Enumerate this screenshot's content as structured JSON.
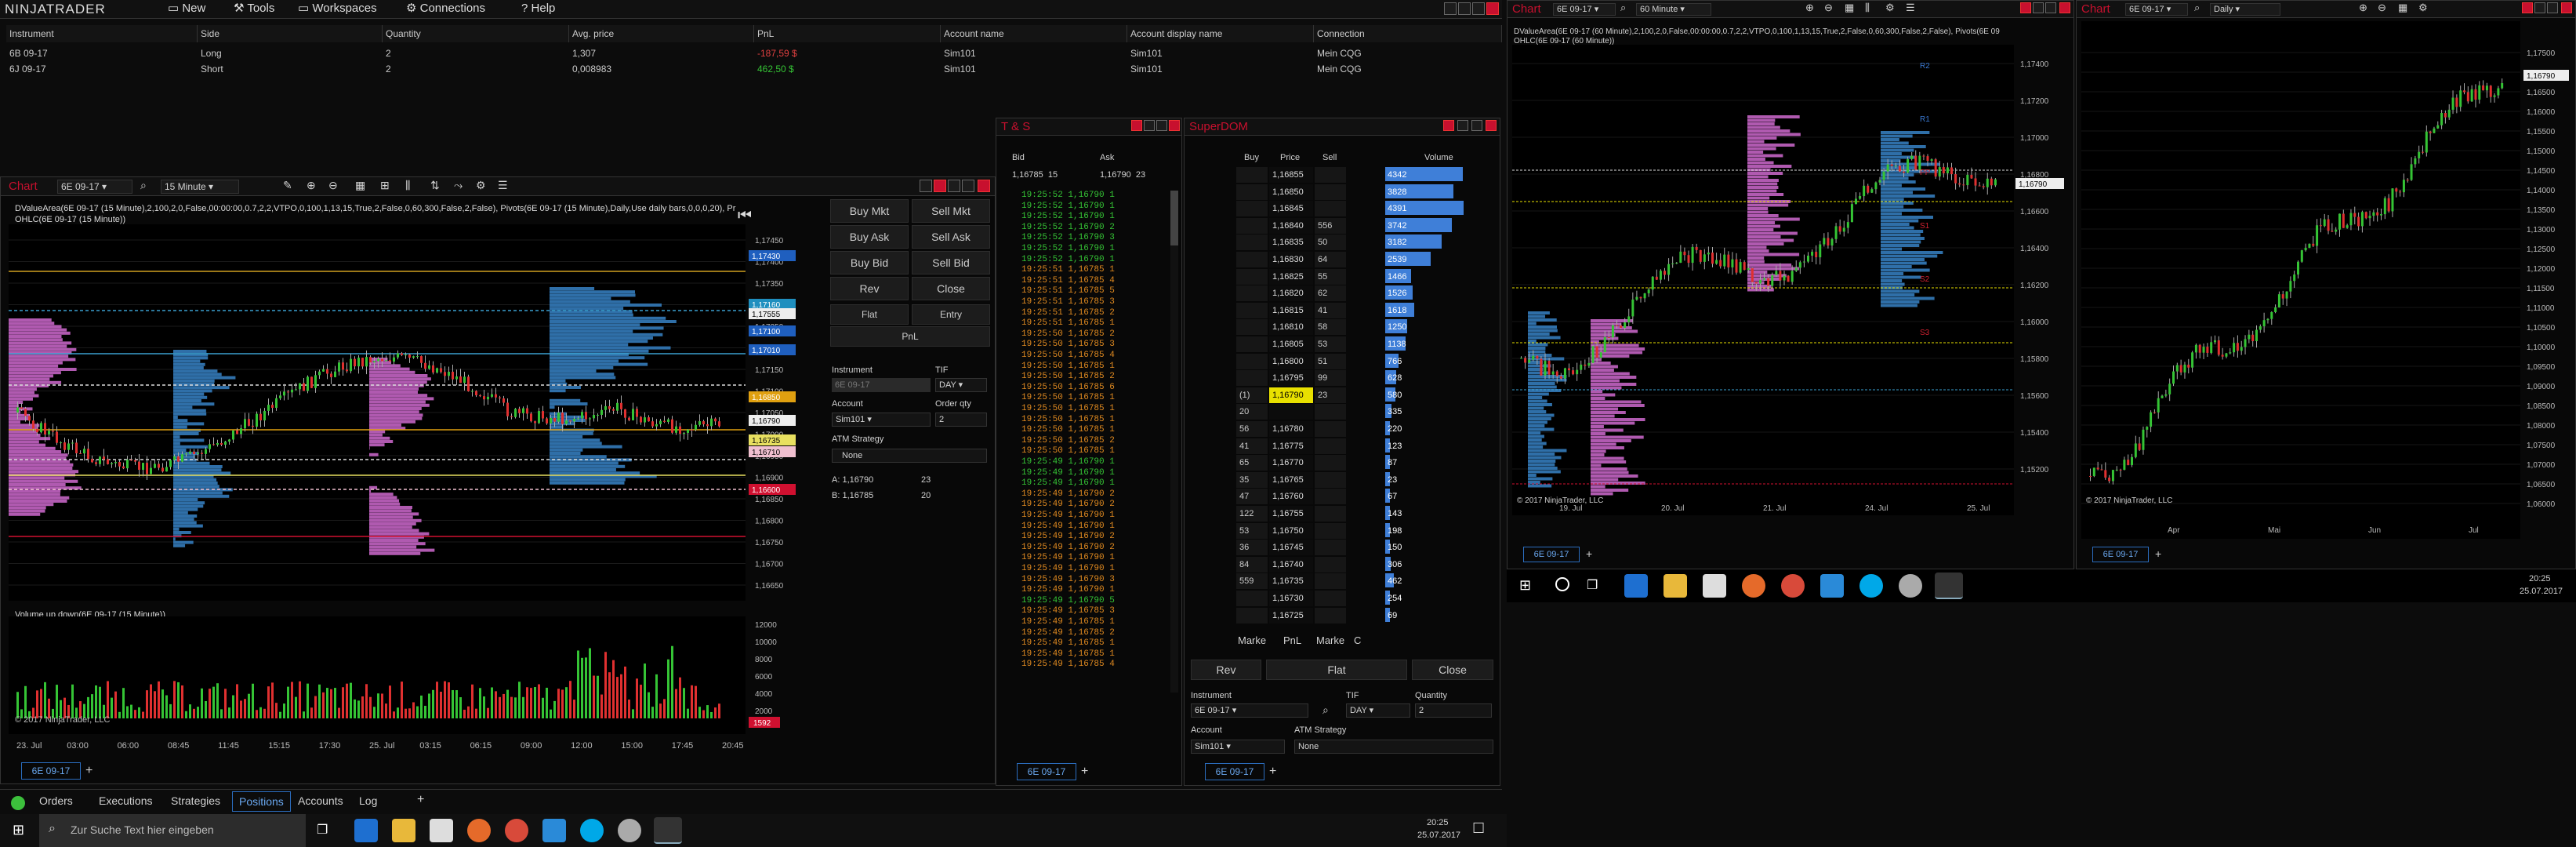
{
  "app": {
    "logo": "NINJATRADER",
    "menu": [
      "New",
      "Tools",
      "Workspaces",
      "Connections",
      "Help"
    ]
  },
  "positions": {
    "headers": [
      "Instrument",
      "Side",
      "Quantity",
      "Avg. price",
      "PnL",
      "Account name",
      "Account display name",
      "Connection"
    ],
    "rows": [
      [
        "6B 09-17",
        "Long",
        "2",
        "1,307",
        "-187,59 $",
        "Sim101",
        "Sim101",
        "Mein CQG"
      ],
      [
        "6J 09-17",
        "Short",
        "2",
        "0,008983",
        "462,50 $",
        "Sim101",
        "Sim101",
        "Mein CQG"
      ]
    ],
    "pnl_colors": [
      "#e04040",
      "#35c435"
    ]
  },
  "chart1": {
    "title": "Chart",
    "instrument": "6E 09-17",
    "interval": "15 Minute",
    "indicator_line1": "DValueArea(6E 09-17 (15 Minute),2,100,2,0,False,00:00:00,0.7,2,2,VTPO,0,100,1,13,15,True,2,False,0,60,300,False,2,False), Pivots(6E 09-17 (15 Minute),Daily,Use daily bars,0,0,0,20), Prior day",
    "indicator_line2": "OHLC(6E 09-17 (15 Minute))",
    "copyright": "© 2017 NinjaTrader, LLC",
    "volume_label": "Volume up down(6E 09-17 (15 Minute))",
    "price_labels": [
      "1,17450",
      "1,17400",
      "1,17350",
      "1,17300",
      "1,17250",
      "1,17200",
      "1,17150",
      "1,17100",
      "1,17050",
      "1,17000",
      "1,16950",
      "1,16900",
      "1,16850",
      "1,16800",
      "1,16750",
      "1,16700",
      "1,16650"
    ],
    "price_tags": [
      {
        "t": "1,17430",
        "c": "#1f5fbf"
      },
      {
        "t": "1,17160",
        "c": "#1f8fbf"
      },
      {
        "t": "1,17555",
        "c": "#eeeeee"
      },
      {
        "t": "1,17100",
        "c": "#1f5fbf"
      },
      {
        "t": "1,17010",
        "c": "#1f5fbf"
      },
      {
        "t": "1,16850",
        "c": "#e0a010"
      },
      {
        "t": "1,16790",
        "c": "#eeeeee"
      },
      {
        "t": "1,16735",
        "c": "#e8e060"
      },
      {
        "t": "1,16710",
        "c": "#f0c0d0"
      },
      {
        "t": "1,16600",
        "c": "#d01030"
      }
    ],
    "volume_labels": [
      "12000",
      "10000",
      "8000",
      "6000",
      "4000",
      "2000"
    ],
    "volume_tag": "1592",
    "time_labels": [
      "23. Jul",
      "03:00",
      "06:00",
      "08:45",
      "11:45",
      "15:15",
      "17:30",
      "25. Jul",
      "03:15",
      "06:15",
      "09:00",
      "12:00",
      "15:00",
      "17:45",
      "20:45"
    ],
    "tab": "6E 09-17"
  },
  "chart_trader": {
    "buttons": [
      "Buy Mkt",
      "Sell Mkt",
      "Buy Ask",
      "Sell Ask",
      "Buy Bid",
      "Sell Bid",
      "Rev",
      "Close",
      "Flat",
      "Entry",
      "PnL"
    ],
    "instrument_label": "Instrument",
    "instrument": "6E 09-17",
    "tif_label": "TIF",
    "tif": "DAY",
    "account_label": "Account",
    "account": "Sim101",
    "qty_label": "Order qty",
    "qty": "2",
    "atm_label": "ATM Strategy",
    "atm": "None",
    "ask_prefix": "A:",
    "ask": "1,16790",
    "ask_size": "23",
    "bid_prefix": "B:",
    "bid": "1,16785",
    "bid_size": "20"
  },
  "ts": {
    "title": "T & S",
    "headers": [
      "Bid",
      "Ask"
    ],
    "bid": "1,16785",
    "bid_size": "15",
    "ask": "1,16790",
    "ask_size": "23",
    "rows": [
      [
        "19:25:52",
        "1,16790",
        "1",
        "g"
      ],
      [
        "19:25:52",
        "1,16790",
        "1",
        "g"
      ],
      [
        "19:25:52",
        "1,16790",
        "1",
        "g"
      ],
      [
        "19:25:52",
        "1,16790",
        "2",
        "g"
      ],
      [
        "19:25:52",
        "1,16790",
        "3",
        "g"
      ],
      [
        "19:25:52",
        "1,16790",
        "1",
        "g"
      ],
      [
        "19:25:52",
        "1,16790",
        "1",
        "g"
      ],
      [
        "19:25:51",
        "1,16785",
        "1",
        "o"
      ],
      [
        "19:25:51",
        "1,16785",
        "4",
        "o"
      ],
      [
        "19:25:51",
        "1,16785",
        "5",
        "o"
      ],
      [
        "19:25:51",
        "1,16785",
        "3",
        "o"
      ],
      [
        "19:25:51",
        "1,16785",
        "2",
        "o"
      ],
      [
        "19:25:51",
        "1,16785",
        "1",
        "o"
      ],
      [
        "19:25:50",
        "1,16785",
        "2",
        "o"
      ],
      [
        "19:25:50",
        "1,16785",
        "3",
        "o"
      ],
      [
        "19:25:50",
        "1,16785",
        "4",
        "o"
      ],
      [
        "19:25:50",
        "1,16785",
        "1",
        "o"
      ],
      [
        "19:25:50",
        "1,16785",
        "2",
        "o"
      ],
      [
        "19:25:50",
        "1,16785",
        "6",
        "o"
      ],
      [
        "19:25:50",
        "1,16785",
        "1",
        "o"
      ],
      [
        "19:25:50",
        "1,16785",
        "1",
        "o"
      ],
      [
        "19:25:50",
        "1,16785",
        "1",
        "o"
      ],
      [
        "19:25:50",
        "1,16785",
        "1",
        "o"
      ],
      [
        "19:25:50",
        "1,16785",
        "2",
        "o"
      ],
      [
        "19:25:50",
        "1,16785",
        "1",
        "o"
      ],
      [
        "19:25:49",
        "1,16790",
        "1",
        "g"
      ],
      [
        "19:25:49",
        "1,16790",
        "1",
        "g"
      ],
      [
        "19:25:49",
        "1,16790",
        "1",
        "g"
      ],
      [
        "19:25:49",
        "1,16790",
        "2",
        "o"
      ],
      [
        "19:25:49",
        "1,16790",
        "2",
        "o"
      ],
      [
        "19:25:49",
        "1,16790",
        "1",
        "o"
      ],
      [
        "19:25:49",
        "1,16790",
        "1",
        "o"
      ],
      [
        "19:25:49",
        "1,16790",
        "2",
        "o"
      ],
      [
        "19:25:49",
        "1,16790",
        "2",
        "o"
      ],
      [
        "19:25:49",
        "1,16790",
        "1",
        "o"
      ],
      [
        "19:25:49",
        "1,16790",
        "1",
        "o"
      ],
      [
        "19:25:49",
        "1,16790",
        "3",
        "o"
      ],
      [
        "19:25:49",
        "1,16790",
        "1",
        "o"
      ],
      [
        "19:25:49",
        "1,16790",
        "5",
        "g"
      ],
      [
        "19:25:49",
        "1,16785",
        "3",
        "o"
      ],
      [
        "19:25:49",
        "1,16785",
        "1",
        "o"
      ],
      [
        "19:25:49",
        "1,16785",
        "2",
        "o"
      ],
      [
        "19:25:49",
        "1,16785",
        "1",
        "o"
      ],
      [
        "19:25:49",
        "1,16785",
        "1",
        "o"
      ],
      [
        "19:25:49",
        "1,16785",
        "4",
        "o"
      ]
    ],
    "tab": "6E 09-17"
  },
  "dom": {
    "title": "SuperDOM",
    "headers": [
      "Buy",
      "Price",
      "Sell",
      "Volume"
    ],
    "rows": [
      [
        "",
        "1,16855",
        "",
        "4342"
      ],
      [
        "",
        "1,16850",
        "",
        "3828"
      ],
      [
        "",
        "1,16845",
        "",
        "4391"
      ],
      [
        "",
        "1,16840",
        "556",
        "3742"
      ],
      [
        "",
        "1,16835",
        "50",
        "3182"
      ],
      [
        "",
        "1,16830",
        "64",
        "2539"
      ],
      [
        "",
        "1,16825",
        "55",
        "1466"
      ],
      [
        "",
        "1,16820",
        "62",
        "1526"
      ],
      [
        "",
        "1,16815",
        "41",
        "1618"
      ],
      [
        "",
        "1,16810",
        "58",
        "1250"
      ],
      [
        "",
        "1,16805",
        "53",
        "1138"
      ],
      [
        "",
        "1,16800",
        "51",
        "766"
      ],
      [
        "",
        "1,16795",
        "99",
        "628"
      ],
      [
        "(1)",
        "1,16790",
        "23",
        "580"
      ],
      [
        "20",
        "",
        "",
        "335"
      ],
      [
        "56",
        "1,16780",
        "",
        "220"
      ],
      [
        "41",
        "1,16775",
        "",
        "123"
      ],
      [
        "65",
        "1,16770",
        "",
        "87"
      ],
      [
        "35",
        "1,16765",
        "",
        "23"
      ],
      [
        "47",
        "1,16760",
        "",
        "67"
      ],
      [
        "122",
        "1,16755",
        "",
        "143"
      ],
      [
        "53",
        "1,16750",
        "",
        "198"
      ],
      [
        "36",
        "1,16745",
        "",
        "150"
      ],
      [
        "84",
        "1,16740",
        "",
        "306"
      ],
      [
        "559",
        "1,16735",
        "",
        "462"
      ],
      [
        "",
        "1,16730",
        "",
        "254"
      ],
      [
        "",
        "1,16725",
        "",
        "69"
      ]
    ],
    "volume_bars": [
      4342,
      3828,
      4391,
      3742,
      3182,
      2539,
      1466,
      1526,
      1618,
      1250,
      1138,
      766,
      628,
      580,
      335,
      220,
      123,
      87,
      23,
      67,
      143,
      198,
      150,
      306,
      462,
      254,
      69
    ],
    "footer": [
      "Marke",
      "PnL",
      "Marke",
      "C"
    ],
    "buttons": [
      "Rev",
      "Flat",
      "Close"
    ],
    "instrument_label": "Instrument",
    "instrument": "6E 09-17",
    "tif_label": "TIF",
    "tif": "DAY",
    "qty_label": "Quantity",
    "qty": "2",
    "account_label": "Account",
    "account": "Sim101",
    "atm_label": "ATM Strategy",
    "atm": "None",
    "tab": "6E 09-17"
  },
  "chart2": {
    "title": "Chart",
    "instrument": "6E 09-17",
    "interval": "60 Minute",
    "indicator_line1": "DValueArea(6E 09-17 (60 Minute),2,100,2,0,False,00:00:00,0.7,2,2,VTPO,0,100,1,13,15,True,2,False,0,60,300,False,2,False), Pivots(6E 09-17 (60 Minute),Daily,Use daily bars,0,0,0,20), Prior day",
    "indicator_line2": "OHLC(6E 09-17 (60 Minute))",
    "copyright": "© 2017 NinjaTrader, LLC",
    "price_labels": [
      "1,17400",
      "1,17200",
      "1,17000",
      "1,16800",
      "1,16600",
      "1,16400",
      "1,16200",
      "1,16000",
      "1,15800",
      "1,15600",
      "1,15400",
      "1,15200"
    ],
    "price_tag": "1,16790",
    "time_labels": [
      "19. Jul",
      "20. Jul",
      "21. Jul",
      "24. Jul",
      "25. Jul"
    ],
    "pivot_labels": [
      "R2",
      "R1",
      "PP",
      "S1",
      "S2",
      "S3"
    ],
    "tab": "6E 09-17"
  },
  "chart3": {
    "title": "Chart",
    "instrument": "6E 09-17",
    "interval": "Daily",
    "copyright": "© 2017 NinjaTrader, LLC",
    "price_labels": [
      "1,17500",
      "1,17000",
      "1,16500",
      "1,16000",
      "1,15500",
      "1,15000",
      "1,14500",
      "1,14000",
      "1,13500",
      "1,13000",
      "1,12500",
      "1,12000",
      "1,11500",
      "1,11000",
      "1,10500",
      "1,10000",
      "1,09500",
      "1,09000",
      "1,08500",
      "1,08000",
      "1,07500",
      "1,07000",
      "1,06500",
      "1,06000"
    ],
    "price_tag": "1,16790",
    "time_labels": [
      "Apr",
      "Mai",
      "Jun",
      "Jul"
    ],
    "tab": "6E 09-17"
  },
  "bottom_tabs": [
    "Orders",
    "Executions",
    "Strategies",
    "Positions",
    "Accounts",
    "Log"
  ],
  "taskbar": {
    "search_placeholder": "Zur Suche Text hier eingeben",
    "time": "20:25",
    "date": "25.07.2017"
  }
}
